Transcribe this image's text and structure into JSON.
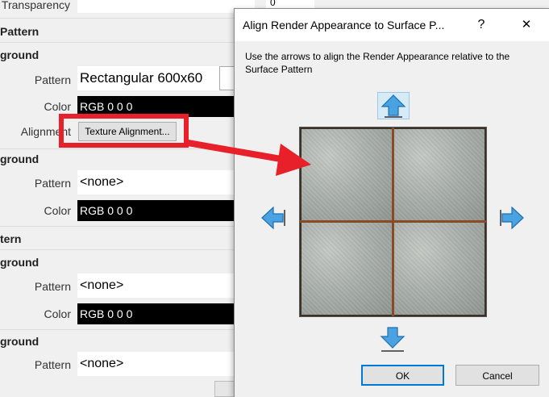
{
  "panel": {
    "transparency_label": "Transparency",
    "surface_pattern_header": "Pattern",
    "fg1_header": "ground",
    "fg1_pattern_label": "Pattern",
    "fg1_pattern_value": "Rectangular 600x60",
    "fg1_color_label": "Color",
    "fg1_color_value": "RGB 0 0 0",
    "alignment_label": "Alignment",
    "texture_alignment_button": "Texture Alignment...",
    "bg1_header": "ground",
    "bg1_pattern_label": "Pattern",
    "bg1_pattern_value": "<none>",
    "bg1_color_label": "Color",
    "bg1_color_value": "RGB 0 0 0",
    "cut_pattern_header": "tern",
    "fg2_header": "ground",
    "fg2_pattern_label": "Pattern",
    "fg2_pattern_value": "<none>",
    "fg2_color_label": "Color",
    "fg2_color_value": "RGB 0 0 0",
    "bg2_header": "ground",
    "bg2_pattern_label": "Pattern",
    "bg2_pattern_value": "<none>",
    "transparency_value": "0"
  },
  "dialog": {
    "title": "Align Render Appearance to Surface P...",
    "help_label": "?",
    "close_label": "✕",
    "instructions": "Use the arrows to align the Render Appearance relative to the Surface Pattern",
    "ok_label": "OK",
    "cancel_label": "Cancel"
  },
  "colors": {
    "highlight": "#e8202a",
    "arrow_blue": "#4aa3e0",
    "ok_border": "#0078d7"
  },
  "icons": [
    "arrow-up-icon",
    "arrow-down-icon",
    "arrow-left-icon",
    "arrow-right-icon",
    "red-pointer-arrow-icon"
  ]
}
